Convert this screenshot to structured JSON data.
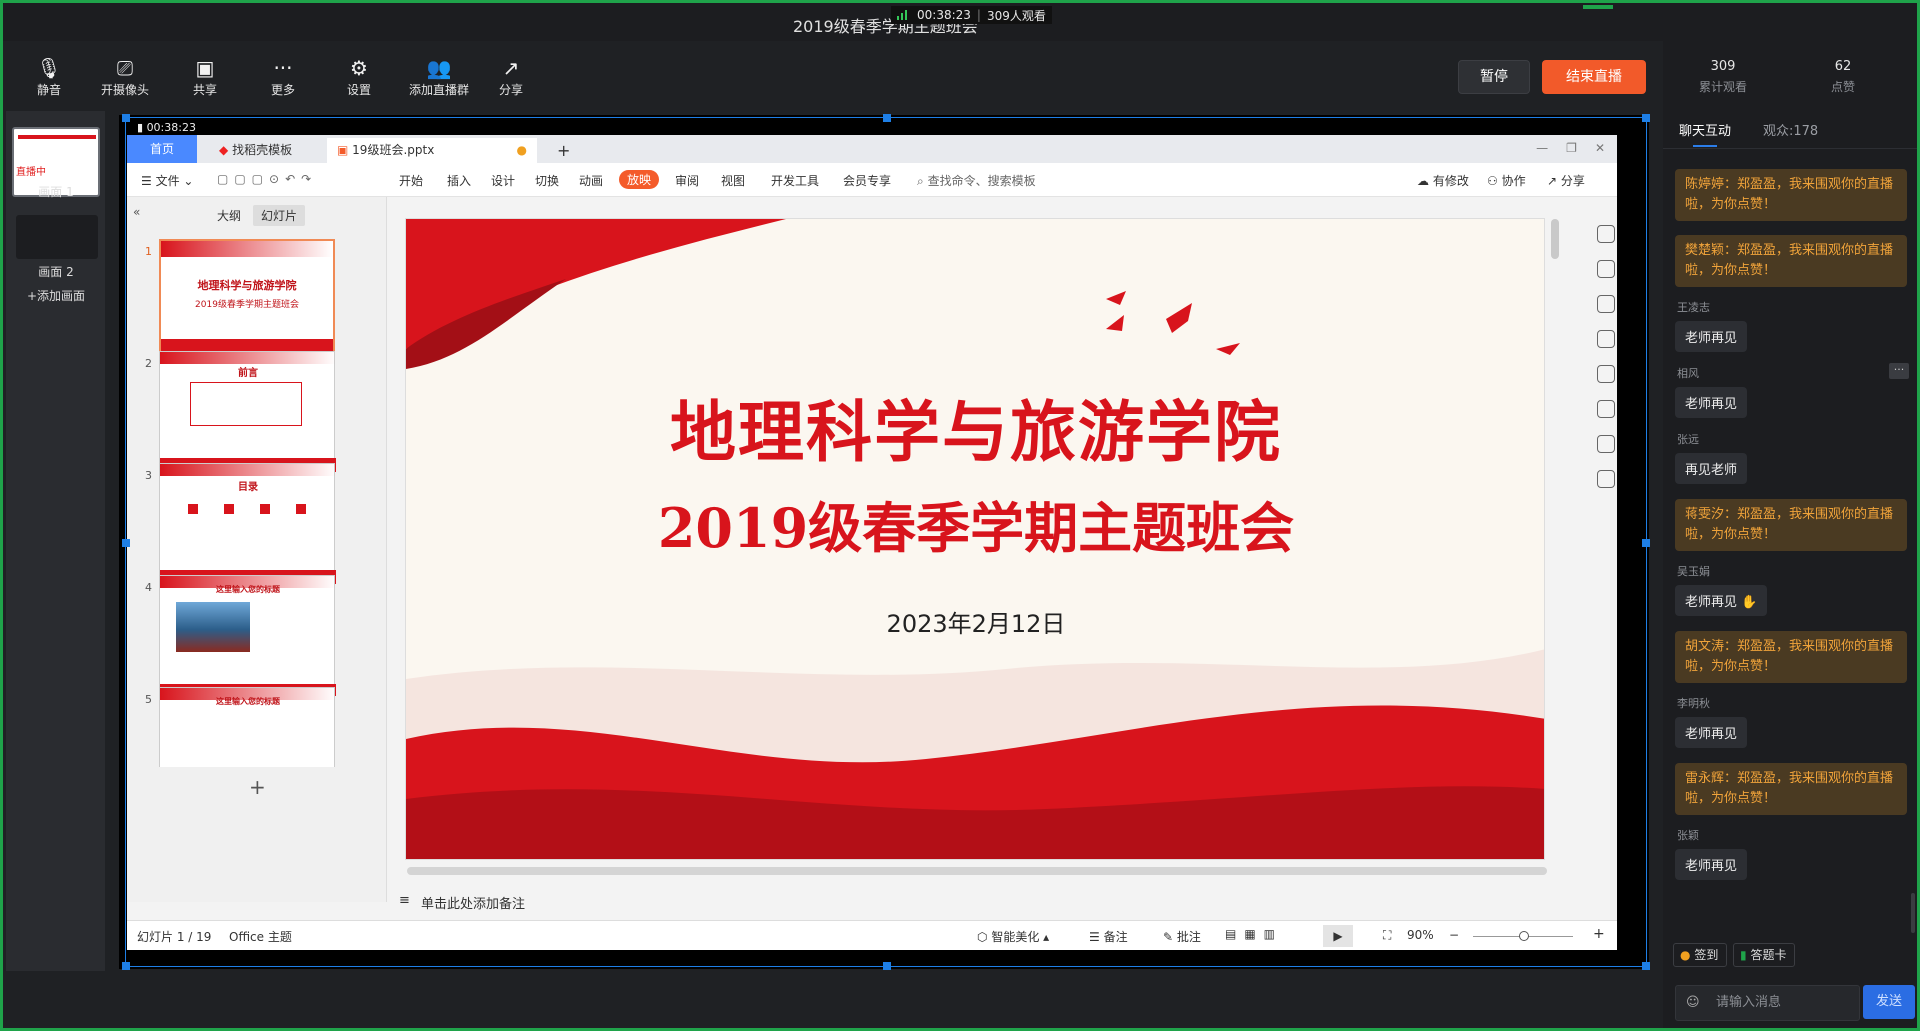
{
  "window": {
    "title": "2019级春季学期主题班会",
    "live_time": "00:38:23",
    "viewers_now": "309人观看"
  },
  "toolbar": {
    "items": [
      {
        "label": "静音"
      },
      {
        "label": "开摄像头"
      },
      {
        "label": "共享"
      },
      {
        "label": "更多"
      },
      {
        "label": "设置"
      },
      {
        "label": "添加直播群"
      },
      {
        "label": "分享"
      }
    ],
    "pause": "暂停",
    "end": "结束直播"
  },
  "scenes": {
    "scene1": "画面 1",
    "live_tag": "直播中",
    "scene2": "画面 2",
    "add": "+添加画面"
  },
  "preview": {
    "timer": "00:38:23"
  },
  "wps": {
    "tabs": {
      "home": "首页",
      "template": "找稻壳模板",
      "file": "19级班会.pptx",
      "add": "+"
    },
    "menu": [
      "文件",
      "开始",
      "插入",
      "设计",
      "切换",
      "动画",
      "放映",
      "审阅",
      "视图",
      "开发工具",
      "会员专享"
    ],
    "search": "查找命令、搜索模板",
    "right_actions": [
      "有修改",
      "协作",
      "分享"
    ],
    "panel_tabs": [
      "大纲",
      "幻灯片"
    ],
    "thumbs": [
      {
        "num": "1",
        "title": "地理科学与旅游学院",
        "sub": "2019级春季学期主题班会"
      },
      {
        "num": "2",
        "title": "前言"
      },
      {
        "num": "3",
        "title": "目录"
      },
      {
        "num": "4",
        "title": "这里输入您的标题"
      },
      {
        "num": "5",
        "title": "这里输入您的标题"
      }
    ],
    "notes": "单击此处添加备注",
    "status": {
      "slide": "幻灯片 1 / 19",
      "theme": "Office 主题",
      "beautify": "智能美化",
      "notes": "备注",
      "comment": "批注",
      "zoom": "90%"
    }
  },
  "slide": {
    "title": "地理科学与旅游学院",
    "subtitle": "2019级春季学期主题班会",
    "date": "2023年2月12日"
  },
  "stats": {
    "total_views": "309",
    "total_views_label": "累计观看",
    "likes": "62",
    "likes_label": "点赞"
  },
  "chat_tabs": {
    "chat": "聊天互动",
    "audience": "观众:178"
  },
  "chat": [
    {
      "type": "sys",
      "text": "陈婷婷：郑盈盈，我来围观你的直播啦，为你点赞！"
    },
    {
      "type": "sys",
      "text": "樊楚颖：郑盈盈，我来围观你的直播啦，为你点赞！"
    },
    {
      "type": "user",
      "name": "王凌志",
      "text": "老师再见"
    },
    {
      "type": "user",
      "name": "相风",
      "text": "老师再见"
    },
    {
      "type": "user",
      "name": "张远",
      "text": "再见老师"
    },
    {
      "type": "sys",
      "text": "蒋雯汐：郑盈盈，我来围观你的直播啦，为你点赞！"
    },
    {
      "type": "user",
      "name": "吴玉娟",
      "text": "老师再见"
    },
    {
      "type": "sys",
      "text": "胡文涛：郑盈盈，我来围观你的直播啦，为你点赞！"
    },
    {
      "type": "user",
      "name": "李明秋",
      "text": "老师再见"
    },
    {
      "type": "sys",
      "text": "雷永辉：郑盈盈，我来围观你的直播啦，为你点赞！"
    },
    {
      "type": "user",
      "name": "张颖",
      "text": "老师再见"
    }
  ],
  "bottom": {
    "checkin": "签到",
    "answer_card": "答题卡",
    "input_placeholder": "请输入消息",
    "send": "发送"
  },
  "colors": {
    "accent_red": "#d8141c",
    "end_button": "#f25a2a",
    "wps_blue": "#4a89ff",
    "frame_green": "#1fa34a"
  }
}
